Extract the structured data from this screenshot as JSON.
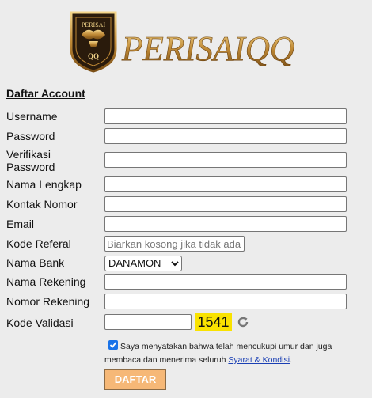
{
  "brand": {
    "name": "PERISAIQQ",
    "logo_text": "PERISAIQQ",
    "badge_top": "PERISAI",
    "badge_bottom": "QQ"
  },
  "form": {
    "title": "Daftar Account",
    "labels": {
      "username": "Username",
      "password": "Password",
      "verify_password": "Verifikasi Password",
      "full_name": "Nama Lengkap",
      "phone": "Kontak Nomor",
      "email": "Email",
      "referral": "Kode Referal",
      "bank": "Nama Bank",
      "account_name": "Nama Rekening",
      "account_number": "Nomor Rekening",
      "captcha": "Kode Validasi"
    },
    "values": {
      "username": "",
      "password": "",
      "verify_password": "",
      "full_name": "",
      "phone": "",
      "email": "",
      "referral": "",
      "account_name": "",
      "account_number": "",
      "captcha": ""
    },
    "placeholders": {
      "referral": "Biarkan kosong jika tidak ada"
    },
    "bank_selected": "DANAMON",
    "captcha_code": "1541",
    "agree_checked": true,
    "agree_text": "Saya menyatakan bahwa telah mencukupi umur dan juga membaca dan menerima seluruh",
    "agree_link": "Syarat & Kondisi",
    "agree_end": ".",
    "submit_label": "DAFTAR"
  },
  "colors": {
    "background": "#ececec",
    "captcha_bg": "#f9e200",
    "submit_bg": "#f6b877",
    "checkbox": "#1a73e8",
    "link": "#1a3fb4",
    "logo_gold": "#b8862f"
  }
}
